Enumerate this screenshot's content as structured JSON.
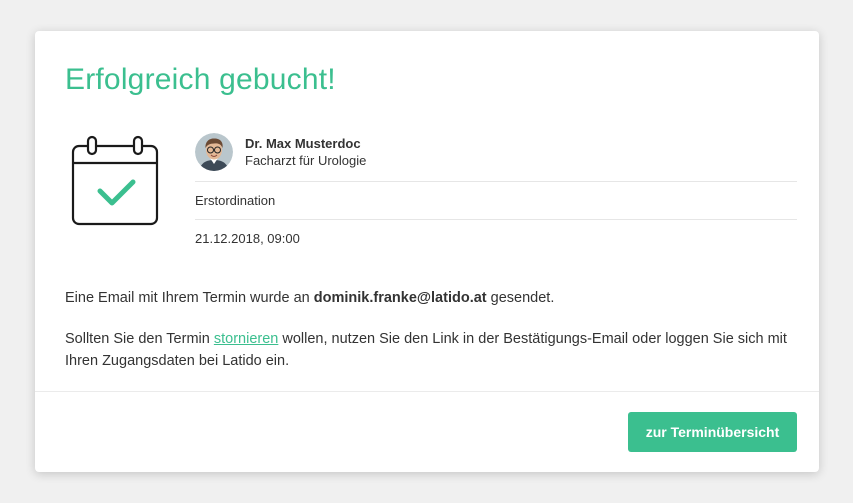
{
  "dialog": {
    "title": "Erfolgreich gebucht!"
  },
  "booking": {
    "doctor_name": "Dr. Max Musterdoc",
    "doctor_specialty": "Facharzt für Urologie",
    "appointment_type": "Erstordination",
    "datetime": "21.12.2018, 09:00"
  },
  "message": {
    "email_prefix": "Eine Email mit Ihrem Termin wurde an ",
    "email": "dominik.franke@latido.at",
    "email_suffix": " gesendet.",
    "cancel_prefix": "Sollten Sie den Termin ",
    "cancel_link": "stornieren",
    "cancel_suffix": " wollen, nutzen Sie den Link in der Bestätigungs-Email oder loggen Sie sich mit Ihren Zugangsdaten bei Latido ein."
  },
  "footer": {
    "button_label": "zur Terminübersicht"
  },
  "icons": {
    "calendar": "calendar-check-icon",
    "avatar": "doctor-avatar"
  },
  "colors": {
    "accent": "#3bbf8f",
    "text": "#333333",
    "background": "#f0f0f0"
  }
}
